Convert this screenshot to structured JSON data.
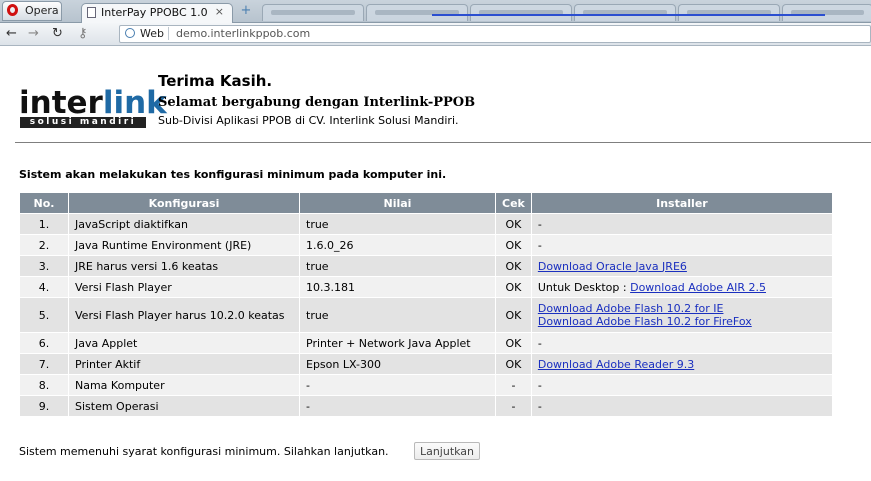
{
  "browser": {
    "opera_label": "Opera",
    "tab_title": "InterPay PPOBC 1.0",
    "tab_close": "×",
    "new_tab": "+",
    "web_label": "Web",
    "url": "demo.interlinkppob.com",
    "colors": {
      "accent_underline": "#2b4fd0",
      "opera_red": "#d01010"
    }
  },
  "header": {
    "logo_inter": "inter",
    "logo_link": "link",
    "logo_tagline": "solusi mandiri",
    "thanks": "Terima Kasih.",
    "welcome": "Selamat bergabung dengan Interlink-PPOB",
    "subdivision": "Sub-Divisi Aplikasi PPOB di CV. Interlink Solusi Mandiri."
  },
  "intro": "Sistem akan melakukan tes konfigurasi minimum pada komputer ini.",
  "table": {
    "headers": [
      "No.",
      "Konfigurasi",
      "Nilai",
      "Cek",
      "Installer"
    ],
    "rows": [
      {
        "no": "1.",
        "config": "JavaScript diaktifkan",
        "value": "true",
        "check": "OK",
        "installer_text": "-"
      },
      {
        "no": "2.",
        "config": "Java Runtime Environment (JRE)",
        "value": "1.6.0_26",
        "check": "OK",
        "installer_text": "-"
      },
      {
        "no": "3.",
        "config": "JRE harus versi 1.6 keatas",
        "value": "true",
        "check": "OK",
        "link1": "Download Oracle Java JRE6"
      },
      {
        "no": "4.",
        "config": "Versi Flash Player",
        "value": "10.3.181",
        "check": "OK",
        "installer_text": "Untuk Desktop : ",
        "link1": "Download Adobe AIR 2.5"
      },
      {
        "no": "5.",
        "config": "Versi Flash Player harus 10.2.0 keatas",
        "value": "true",
        "check": "OK",
        "link1": "Download Adobe Flash 10.2 for IE",
        "link2": "Download Adobe Flash 10.2 for FireFox"
      },
      {
        "no": "6.",
        "config": "Java Applet",
        "value": "Printer + Network Java Applet",
        "check": "OK",
        "installer_text": "-"
      },
      {
        "no": "7.",
        "config": "Printer Aktif",
        "value": "Epson LX-300",
        "check": "OK",
        "link1": "Download Adobe Reader 9.3"
      },
      {
        "no": "8.",
        "config": "Nama Komputer",
        "value": "-",
        "check": "-",
        "installer_text": "-"
      },
      {
        "no": "9.",
        "config": "Sistem Operasi",
        "value": "-",
        "check": "-",
        "installer_text": "-"
      }
    ]
  },
  "footer": {
    "message": "Sistem memenuhi syarat konfigurasi minimum. Silahkan lanjutkan.",
    "button": "Lanjutkan"
  },
  "colors": {
    "table_header_bg": "#7f8c98",
    "row_odd": "#e3e3e3",
    "row_even": "#f1f1f1",
    "link": "#1a2fbf",
    "logo_link": "#1f6aa5"
  }
}
